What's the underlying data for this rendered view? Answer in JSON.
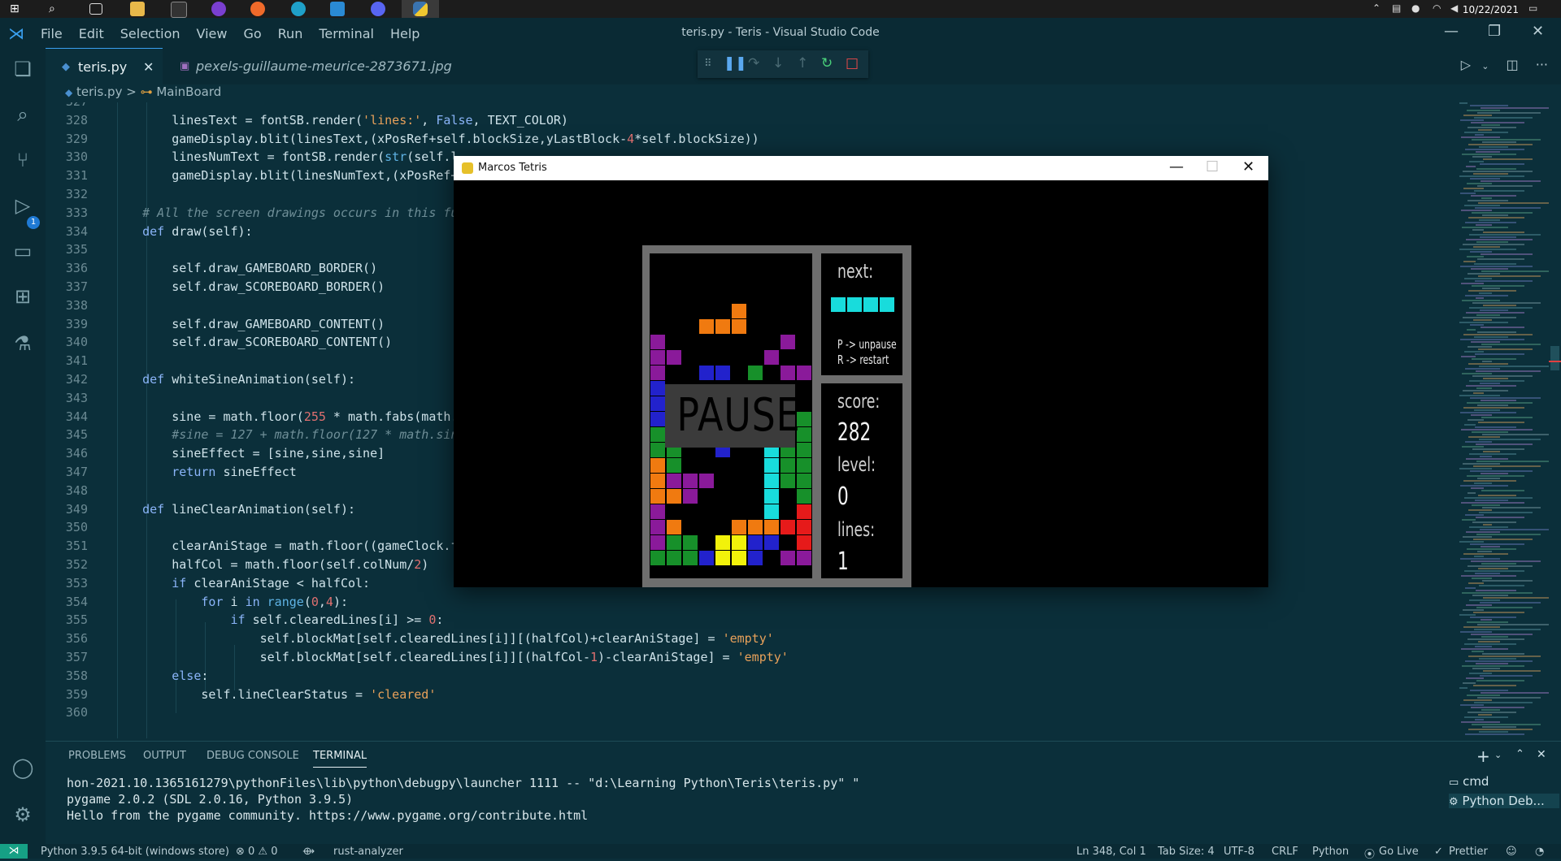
{
  "taskbar": {
    "date": "10/22/2021"
  },
  "window": {
    "title": "teris.py - Teris - Visual Studio Code"
  },
  "menu": [
    "File",
    "Edit",
    "Selection",
    "View",
    "Go",
    "Run",
    "Terminal",
    "Help"
  ],
  "tabs": [
    {
      "label": "teris.py",
      "active": true
    },
    {
      "label": "pexels-guillaume-meurice-2873671.jpg",
      "active": false
    }
  ],
  "breadcrumb": {
    "file": "teris.py",
    "symbol": "MainBoard"
  },
  "activity": {
    "badge": "1"
  },
  "editor": {
    "lines": [
      {
        "n": "327",
        "t": ""
      },
      {
        "n": "328",
        "t": "        linesText = fontSB.render('lines:', False, TEXT_COLOR)"
      },
      {
        "n": "329",
        "t": "        gameDisplay.blit(linesText,(xPosRef+self.blockSize,yLastBlock-4*self.blockSize))"
      },
      {
        "n": "330",
        "t": "        linesNumText = fontSB.render(str(self.l"
      },
      {
        "n": "331",
        "t": "        gameDisplay.blit(linesNumText,(xPosRef+"
      },
      {
        "n": "332",
        "t": ""
      },
      {
        "n": "333",
        "t": "    # All the screen drawings occurs in this fu"
      },
      {
        "n": "334",
        "t": "    def draw(self):"
      },
      {
        "n": "335",
        "t": ""
      },
      {
        "n": "336",
        "t": "        self.draw_GAMEBOARD_BORDER()"
      },
      {
        "n": "337",
        "t": "        self.draw_SCOREBOARD_BORDER()"
      },
      {
        "n": "338",
        "t": ""
      },
      {
        "n": "339",
        "t": "        self.draw_GAMEBOARD_CONTENT()"
      },
      {
        "n": "340",
        "t": "        self.draw_SCOREBOARD_CONTENT()"
      },
      {
        "n": "341",
        "t": ""
      },
      {
        "n": "342",
        "t": "    def whiteSineAnimation(self):"
      },
      {
        "n": "343",
        "t": ""
      },
      {
        "n": "344",
        "t": "        sine = math.floor(255 * math.fabs(math."
      },
      {
        "n": "345",
        "t": "        #sine = 127 + math.floor(127 * math.sin"
      },
      {
        "n": "346",
        "t": "        sineEffect = [sine,sine,sine]"
      },
      {
        "n": "347",
        "t": "        return sineEffect"
      },
      {
        "n": "348",
        "t": ""
      },
      {
        "n": "349",
        "t": "    def lineClearAnimation(self):"
      },
      {
        "n": "350",
        "t": ""
      },
      {
        "n": "351",
        "t": "        clearAniStage = math.floor((gameClock.f"
      },
      {
        "n": "352",
        "t": "        halfCol = math.floor(self.colNum/2)"
      },
      {
        "n": "353",
        "t": "        if clearAniStage < halfCol:"
      },
      {
        "n": "354",
        "t": "            for i in range(0,4):"
      },
      {
        "n": "355",
        "t": "                if self.clearedLines[i] >= 0:"
      },
      {
        "n": "356",
        "t": "                    self.blockMat[self.clearedLines[i]][(halfCol)+clearAniStage] = 'empty'"
      },
      {
        "n": "357",
        "t": "                    self.blockMat[self.clearedLines[i]][(halfCol-1)-clearAniStage] = 'empty'"
      },
      {
        "n": "358",
        "t": "        else:"
      },
      {
        "n": "359",
        "t": "            self.lineClearStatus = 'cleared'"
      },
      {
        "n": "360",
        "t": ""
      }
    ]
  },
  "panel": {
    "tabs": [
      "PROBLEMS",
      "OUTPUT",
      "DEBUG CONSOLE",
      "TERMINAL"
    ],
    "terminal_lines": [
      "hon-2021.10.1365161279\\pythonFiles\\lib\\python\\debugpy\\launcher 1111 -- \"d:\\Learning Python\\Teris\\teris.py\" \"",
      "pygame 2.0.2 (SDL 2.0.16, Python 3.9.5)",
      "Hello from the pygame community. https://www.pygame.org/contribute.html"
    ],
    "terminals": [
      "cmd",
      "Python Deb..."
    ]
  },
  "statusbar": {
    "interpreter": "Python 3.9.5 64-bit (windows store)",
    "problems": "⊗ 0 ⚠ 0",
    "analyzer": "rust-analyzer",
    "position": "Ln 348, Col 1",
    "tabsize": "Tab Size: 4",
    "encoding": "UTF-8",
    "eol": "CRLF",
    "language": "Python",
    "golive": "Go Live",
    "prettier": "Prettier"
  },
  "pygame": {
    "title": "Marcos Tetris",
    "next_label": "next:",
    "hint1": "P -> unpause",
    "hint2": "R -> restart",
    "pause": "PAUSE",
    "score_label": "score:",
    "score": "282",
    "level_label": "level:",
    "level": "0",
    "lines_label": "lines:",
    "lines": "1"
  },
  "colors": {
    "purple": "#8a1a9a",
    "orange": "#f07a10",
    "blue": "#2222cc",
    "green": "#17902a",
    "cyan": "#18dcdc",
    "yellow": "#f2f20a",
    "red": "#e61a1a"
  }
}
